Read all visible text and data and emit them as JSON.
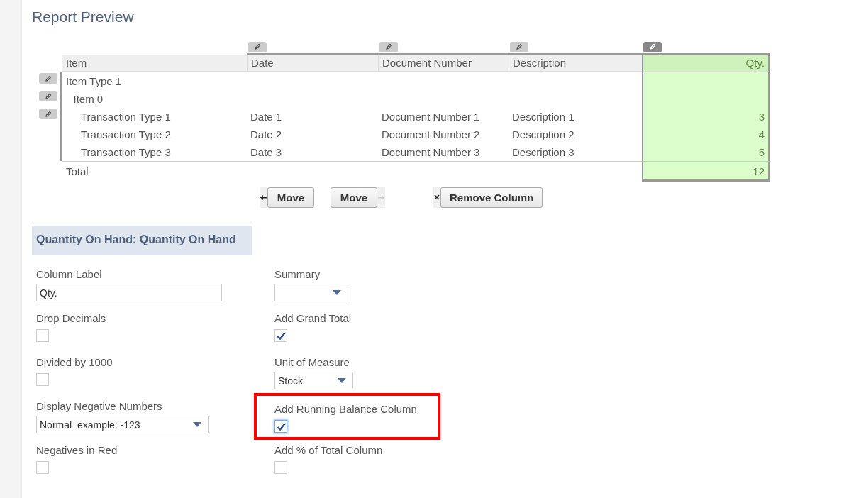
{
  "title": "Report Preview",
  "report": {
    "columns": [
      {
        "label": "Item",
        "kind": "text",
        "edit_button": false,
        "selected": false
      },
      {
        "label": "Date",
        "kind": "text",
        "edit_button": true,
        "selected": false
      },
      {
        "label": "Document Number",
        "kind": "text",
        "edit_button": true,
        "selected": false
      },
      {
        "label": "Description",
        "kind": "text",
        "edit_button": true,
        "selected": false
      },
      {
        "label": "Qty.",
        "kind": "number",
        "edit_button": true,
        "selected": true
      }
    ],
    "rows": [
      {
        "cells": [
          "Item Type 1"
        ],
        "edit_button": true,
        "children": [
          {
            "cells": [
              "Item 0"
            ],
            "edit_button": true,
            "children": [
              {
                "cells": [
                  "Transaction Type 1",
                  "Date 1",
                  "Document Number 1",
                  "Description 1",
                  "3"
                ],
                "edit_button": true
              },
              {
                "cells": [
                  "Transaction Type 2",
                  "Date 2",
                  "Document Number 2",
                  "Description 2",
                  "4"
                ],
                "edit_button": false
              },
              {
                "cells": [
                  "Transaction Type 3",
                  "Date 3",
                  "Document Number 3",
                  "Description 3",
                  "5"
                ],
                "edit_button": false
              }
            ]
          }
        ]
      }
    ],
    "total": {
      "label": "Total",
      "value": "12"
    }
  },
  "actions": [
    {
      "label": "Move",
      "kind": "move-left"
    },
    {
      "label": "Move",
      "kind": "move-right"
    },
    {
      "label": "Remove Column",
      "kind": "remove"
    }
  ],
  "section": {
    "title": "Quantity On Hand: Quantity On Hand"
  },
  "form_rows": [
    [
      {
        "label": "Column Label",
        "kind": "text",
        "value": "Qty."
      },
      {
        "label": "Summary",
        "kind": "select"
      }
    ],
    [
      {
        "label": "Drop Decimals",
        "kind": "checkbox",
        "checked": false
      },
      {
        "label": "Add Grand Total",
        "kind": "checkbox",
        "checked": true
      }
    ],
    [
      {
        "label": "Divided by 1000",
        "kind": "checkbox",
        "checked": false
      },
      {
        "label": "Unit of Measure",
        "kind": "select",
        "value": "Stock"
      }
    ],
    [
      {
        "label": "Display Negative Numbers",
        "kind": "select",
        "value": "Normal  example: -123"
      },
      {
        "label": "Add Running Balance Column",
        "kind": "checkbox",
        "checked": true,
        "focused": true,
        "highlighted": true
      }
    ],
    [
      {
        "label": "Negatives in Red",
        "kind": "checkbox",
        "checked": false
      },
      {
        "label": "Add % of Total Column",
        "kind": "checkbox",
        "checked": false
      }
    ]
  ]
}
